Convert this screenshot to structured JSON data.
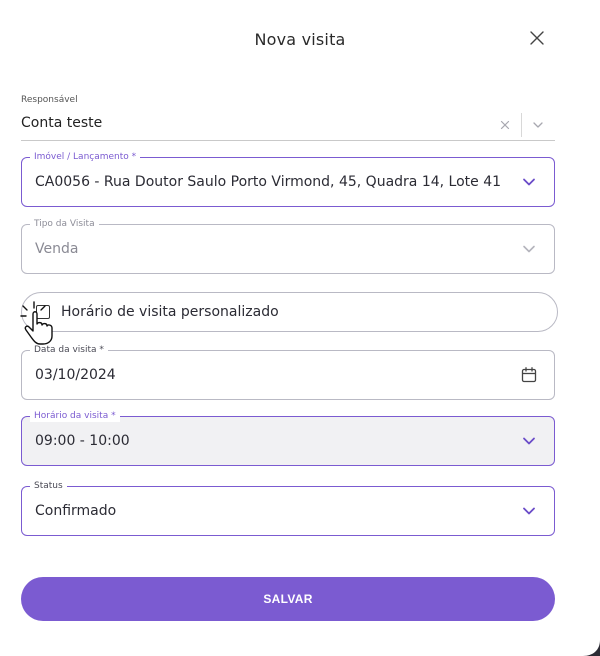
{
  "modal": {
    "title": "Nova visita",
    "close_icon": "close-icon"
  },
  "responsavel": {
    "label": "Responsável",
    "value": "Conta teste"
  },
  "imovel": {
    "label": "Imóvel / Lançamento *",
    "value": "CA0056 - Rua Doutor Saulo Porto Virmond, 45, Quadra 14, Lote 41 ..."
  },
  "tipo_visita": {
    "label": "Tipo da Visita",
    "value": "Venda"
  },
  "custom_time": {
    "label": "Horário de visita personalizado",
    "checked": false
  },
  "data_visita": {
    "label": "Data da visita *",
    "value": "03/10/2024"
  },
  "horario_visita": {
    "label": "Horário da visita *",
    "value": "09:00 - 10:00"
  },
  "status": {
    "label": "Status",
    "value": "Confirmado"
  },
  "actions": {
    "save_label": "SALVAR"
  },
  "colors": {
    "accent": "#7b5bd1",
    "border": "#b9b9c4",
    "focused_bg": "#f1f1f3"
  },
  "icons": [
    "close-icon",
    "clear-icon",
    "chevron-down-icon",
    "calendar-icon",
    "checkbox-icon",
    "hand-pointer-icon"
  ]
}
